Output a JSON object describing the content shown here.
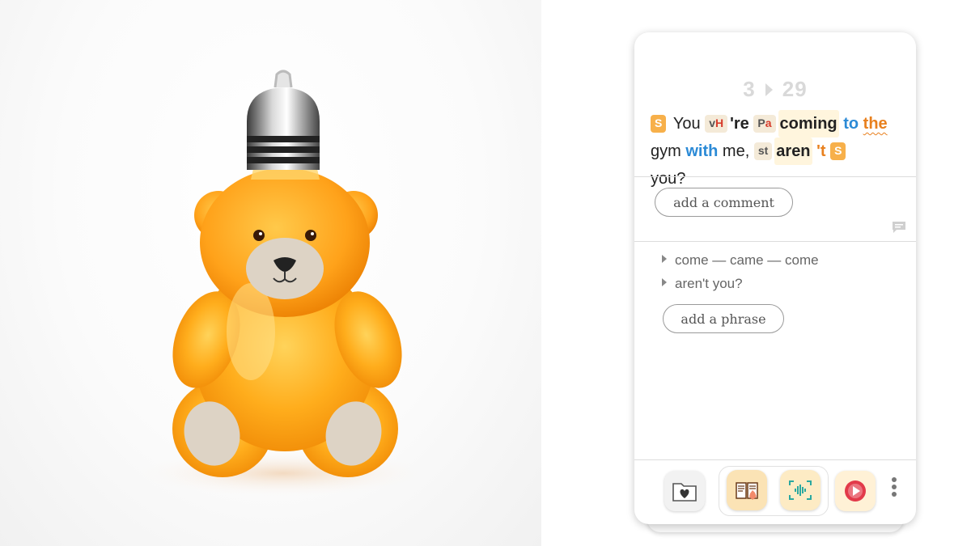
{
  "card": {
    "counter": {
      "current": "3",
      "total": "29"
    },
    "sentence": {
      "tag_subject": "S",
      "w_you": "You",
      "tag_vh_v": "v",
      "tag_vh_h": "H",
      "w_re": "'re",
      "tag_pa_p": "P",
      "tag_pa_a": "a",
      "w_coming": "coming",
      "w_to": "to",
      "w_the": "the",
      "w_gym": "gym",
      "w_with": "with",
      "w_me": "me,",
      "tag_st": "st",
      "w_aren": "aren",
      "w_t": "'t",
      "tag_subject2": "S",
      "w_you2": "you?"
    },
    "add_comment_label": "add a comment",
    "phrases": [
      "come — came  — come",
      "aren't you?"
    ],
    "add_phrase_label": "add a phrase"
  },
  "colors": {
    "accent_orange": "#f7b04a",
    "link_blue": "#2b8ad6",
    "orange_text": "#e8801e"
  },
  "icons": [
    "comment-icon",
    "folder-heart-icon",
    "book-hand-icon",
    "voice-scan-icon",
    "play-record-icon",
    "kebab-menu-icon"
  ]
}
